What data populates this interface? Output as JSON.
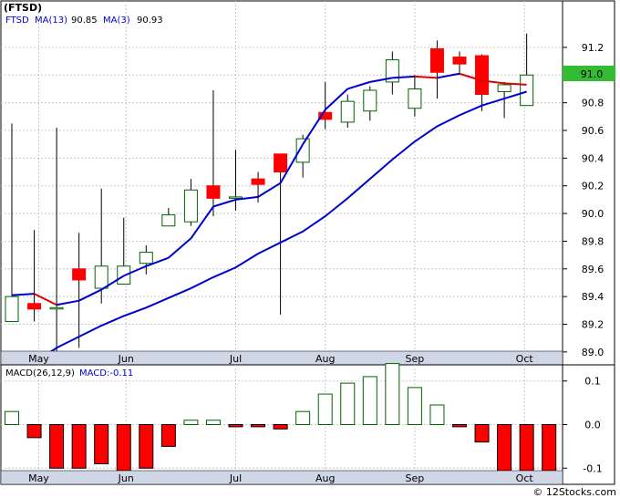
{
  "chart_data": {
    "type": "candlestick",
    "ticker": "(FTSD)",
    "colors": {
      "up_body": "#ffffff",
      "up_stroke": "#006400",
      "down_body": "#ff0000",
      "wick": "#000000",
      "ma_fast_rising": "#0000cc",
      "ma_fast_falling": "#dd0000",
      "ma_slow": "#0000cc",
      "last_price_bg": "#33bb33",
      "macd_pos_stroke": "#006400",
      "macd_neg_fill": "#ff0000",
      "header_blue": "#0000cc",
      "grid": "#c8c8c8",
      "time_axis_bg": "#cfd6e6"
    },
    "legend": {
      "ticker_label": "FTSD",
      "ma13_label": "MA(13)",
      "ma13_value": "90.85",
      "ma3_label": "MA(3)",
      "ma3_value": "90.93"
    },
    "last_price_label": "91.0",
    "price_axis": {
      "ylim": [
        88.92,
        91.45
      ],
      "ticks": [
        89.0,
        89.2,
        89.4,
        89.6,
        89.8,
        90.0,
        90.2,
        90.4,
        90.6,
        90.8,
        91.0,
        91.2
      ],
      "tick_labels": [
        "89.0",
        "89.2",
        "89.4",
        "89.6",
        "89.8",
        "90.0",
        "90.2",
        "90.4",
        "90.6",
        "90.8",
        "91.0",
        "91.2"
      ]
    },
    "x_axis": {
      "bar_count": 25,
      "months": [
        {
          "label": "May",
          "at": 1.2
        },
        {
          "label": "Jun",
          "at": 5.1
        },
        {
          "label": "Jul",
          "at": 10.0
        },
        {
          "label": "Aug",
          "at": 14.0
        },
        {
          "label": "Sep",
          "at": 18.0
        },
        {
          "label": "Oct",
          "at": 22.9
        }
      ]
    },
    "candles": [
      {
        "o": 89.22,
        "h": 90.65,
        "l": 89.22,
        "c": 89.4
      },
      {
        "o": 89.35,
        "h": 89.88,
        "l": 89.22,
        "c": 89.31
      },
      {
        "o": 89.32,
        "h": 90.62,
        "l": 88.95,
        "c": 89.32
      },
      {
        "o": 89.6,
        "h": 89.86,
        "l": 89.03,
        "c": 89.52
      },
      {
        "o": 89.46,
        "h": 90.18,
        "l": 89.35,
        "c": 89.62
      },
      {
        "o": 89.49,
        "h": 89.97,
        "l": 89.49,
        "c": 89.62
      },
      {
        "o": 89.64,
        "h": 89.77,
        "l": 89.56,
        "c": 89.72
      },
      {
        "o": 89.91,
        "h": 90.04,
        "l": 89.91,
        "c": 89.99
      },
      {
        "o": 89.94,
        "h": 90.25,
        "l": 89.91,
        "c": 90.17
      },
      {
        "o": 90.2,
        "h": 90.89,
        "l": 89.98,
        "c": 90.11
      },
      {
        "o": 90.12,
        "h": 90.46,
        "l": 90.02,
        "c": 90.12
      },
      {
        "o": 90.25,
        "h": 90.3,
        "l": 90.08,
        "c": 90.21
      },
      {
        "o": 90.43,
        "h": 90.43,
        "l": 89.27,
        "c": 90.3
      },
      {
        "o": 90.37,
        "h": 90.57,
        "l": 90.26,
        "c": 90.54
      },
      {
        "o": 90.73,
        "h": 90.95,
        "l": 90.61,
        "c": 90.68
      },
      {
        "o": 90.66,
        "h": 90.86,
        "l": 90.62,
        "c": 90.81
      },
      {
        "o": 90.74,
        "h": 90.92,
        "l": 90.67,
        "c": 90.89
      },
      {
        "o": 90.95,
        "h": 91.17,
        "l": 90.86,
        "c": 91.11
      },
      {
        "o": 90.76,
        "h": 91.0,
        "l": 90.7,
        "c": 90.9
      },
      {
        "o": 91.19,
        "h": 91.25,
        "l": 90.83,
        "c": 91.02
      },
      {
        "o": 91.13,
        "h": 91.17,
        "l": 91.0,
        "c": 91.08
      },
      {
        "o": 91.14,
        "h": 91.15,
        "l": 90.74,
        "c": 90.86
      },
      {
        "o": 90.88,
        "h": 90.95,
        "l": 90.69,
        "c": 90.93
      },
      {
        "o": 90.78,
        "h": 91.3,
        "l": 90.78,
        "c": 91.0
      }
    ],
    "ma3": [
      89.41,
      89.42,
      89.34,
      89.37,
      89.45,
      89.55,
      89.62,
      89.68,
      89.82,
      90.05,
      90.1,
      90.12,
      90.22,
      90.5,
      90.75,
      90.9,
      90.95,
      90.98,
      90.99,
      90.98,
      91.01,
      90.96,
      90.94,
      90.93
    ],
    "ma3_falling": [
      false,
      false,
      true,
      false,
      false,
      false,
      false,
      false,
      false,
      false,
      false,
      false,
      false,
      false,
      false,
      false,
      false,
      false,
      false,
      true,
      false,
      true,
      true,
      true
    ],
    "ma13": [
      88.92,
      89.03,
      89.11,
      89.19,
      89.26,
      89.32,
      89.39,
      89.46,
      89.54,
      89.61,
      89.71,
      89.79,
      89.87,
      89.98,
      90.11,
      90.25,
      90.39,
      90.52,
      90.63,
      90.71,
      90.78,
      90.83,
      90.88
    ],
    "ma13_start": 1,
    "macd_legend": {
      "label": "MACD(26,12,9)",
      "value_label": "MACD:-0.11"
    },
    "macd_axis": {
      "ylim": [
        -0.135,
        0.135
      ],
      "ticks": [
        0.1,
        0.0,
        -0.1
      ],
      "tick_labels": [
        "0.1",
        "0.0",
        "-0.1"
      ]
    },
    "macd": [
      0.03,
      -0.03,
      -0.1,
      -0.1,
      -0.09,
      -0.11,
      -0.1,
      -0.05,
      0.01,
      0.01,
      -0.005,
      -0.005,
      -0.01,
      0.03,
      0.07,
      0.095,
      0.11,
      0.14,
      0.085,
      0.045,
      -0.005,
      -0.04,
      -0.135,
      -0.19,
      -0.215
    ]
  },
  "watermark": "© 12Stocks.com"
}
